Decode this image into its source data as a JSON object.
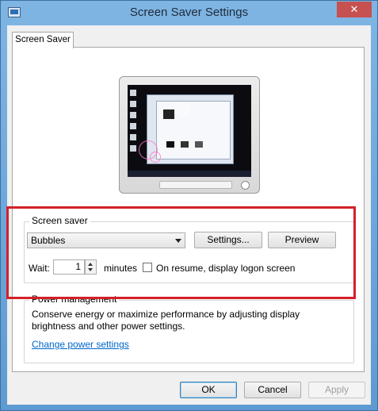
{
  "window": {
    "title": "Screen Saver Settings",
    "close_label": "✕"
  },
  "tabs": [
    {
      "label": "Screen Saver"
    }
  ],
  "screen_saver": {
    "group_label": "Screen saver",
    "selected": "Bubbles",
    "settings_button": "Settings...",
    "preview_button": "Preview",
    "wait_label": "Wait:",
    "wait_value": "1",
    "minutes_label": "minutes",
    "resume_checked": false,
    "resume_label": "On resume, display logon screen"
  },
  "power_management": {
    "group_label": "Power management",
    "description_line1": "Conserve energy or maximize performance by adjusting display",
    "description_line2": "brightness and other power settings.",
    "link": "Change power settings"
  },
  "footer": {
    "ok": "OK",
    "cancel": "Cancel",
    "apply": "Apply"
  },
  "colors": {
    "highlight": "#d4202a",
    "link": "#0066cc",
    "title_bar": "#6ea6d6",
    "close_button": "#c75050"
  }
}
